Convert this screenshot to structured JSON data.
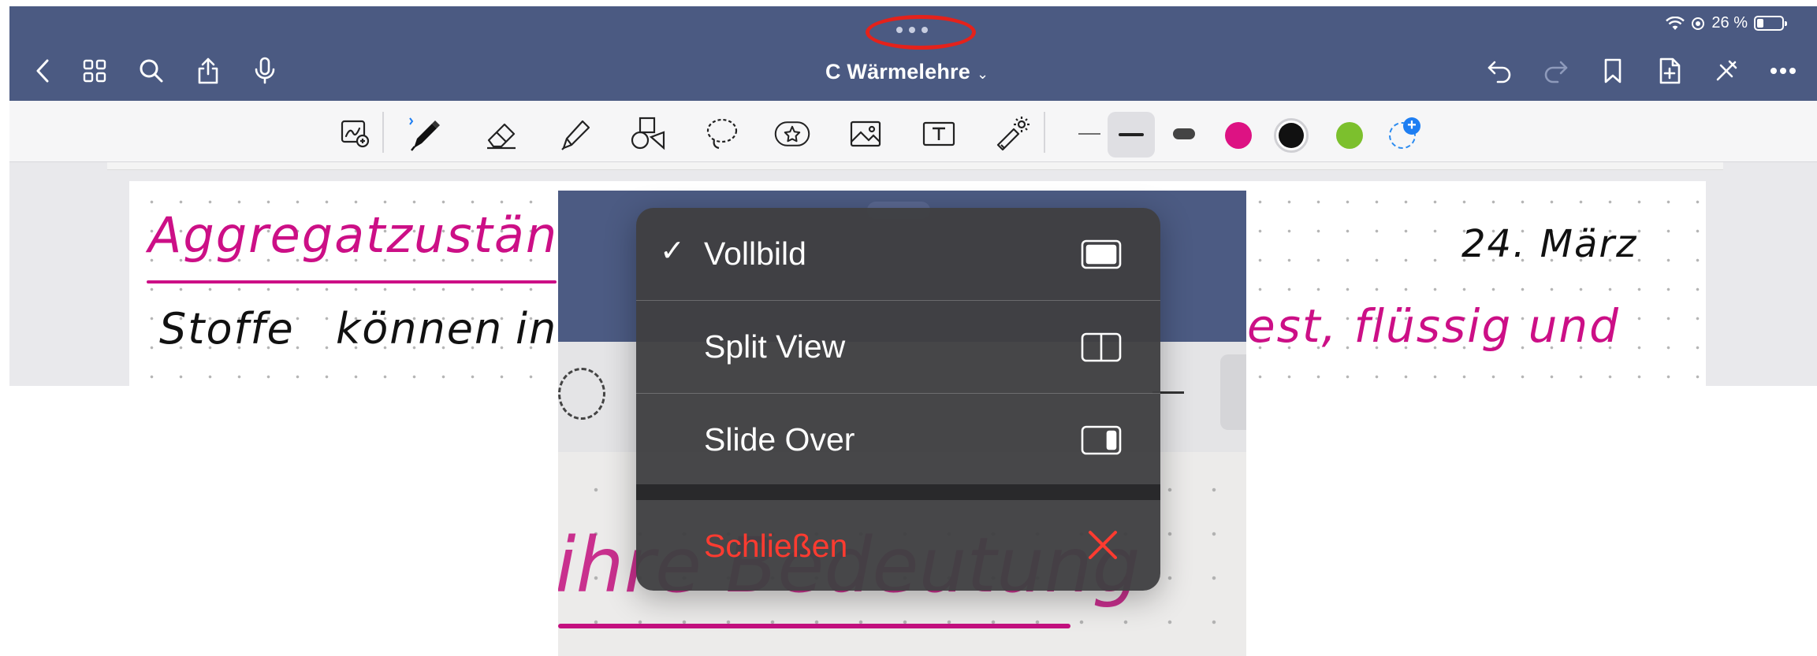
{
  "status_bar": {
    "battery_text": "26 %",
    "icons": [
      "wifi-icon",
      "location-icon",
      "battery-icon"
    ]
  },
  "navbar": {
    "title": "C Wärmelehre",
    "left_icons": [
      "back-icon",
      "grid-icon",
      "search-icon",
      "share-icon",
      "microphone-icon"
    ],
    "right_icons": [
      "undo-icon",
      "redo-icon",
      "bookmark-icon",
      "add-page-icon",
      "close-edit-icon",
      "more-icon"
    ]
  },
  "toolbar": {
    "tools": [
      "zoom-window-icon",
      "pen-icon",
      "eraser-icon",
      "highlighter-icon",
      "shapes-icon",
      "lasso-icon",
      "sticker-icon",
      "image-icon",
      "text-icon",
      "laser-icon"
    ],
    "stroke_widths": [
      "thin",
      "medium",
      "thick"
    ],
    "selected_stroke": "medium",
    "colors": [
      "#dd1283",
      "#111111",
      "#7cc02d"
    ],
    "selected_color": "#111111"
  },
  "note": {
    "heading": "Aggregatzustände",
    "date": "24. März",
    "line1_left": [
      "Stoffe",
      "können",
      "in"
    ],
    "line1_right": "est, flüssig und"
  },
  "preview": {
    "handwriting": "ihre Bedeutung"
  },
  "multitasking_menu": {
    "items": [
      {
        "label": "Vollbild",
        "checked": true,
        "icon": "fullscreen-icon"
      },
      {
        "label": "Split View",
        "checked": false,
        "icon": "split-view-icon"
      },
      {
        "label": "Slide Over",
        "checked": false,
        "icon": "slide-over-icon"
      }
    ],
    "close": {
      "label": "Schließen",
      "icon": "close-icon"
    },
    "check_mark": "✓"
  },
  "colors": {
    "navbar": "#4b5a82",
    "accent_pink": "#cc0f86",
    "destructive": "#ff3b30",
    "menu_bg": "#404042"
  }
}
